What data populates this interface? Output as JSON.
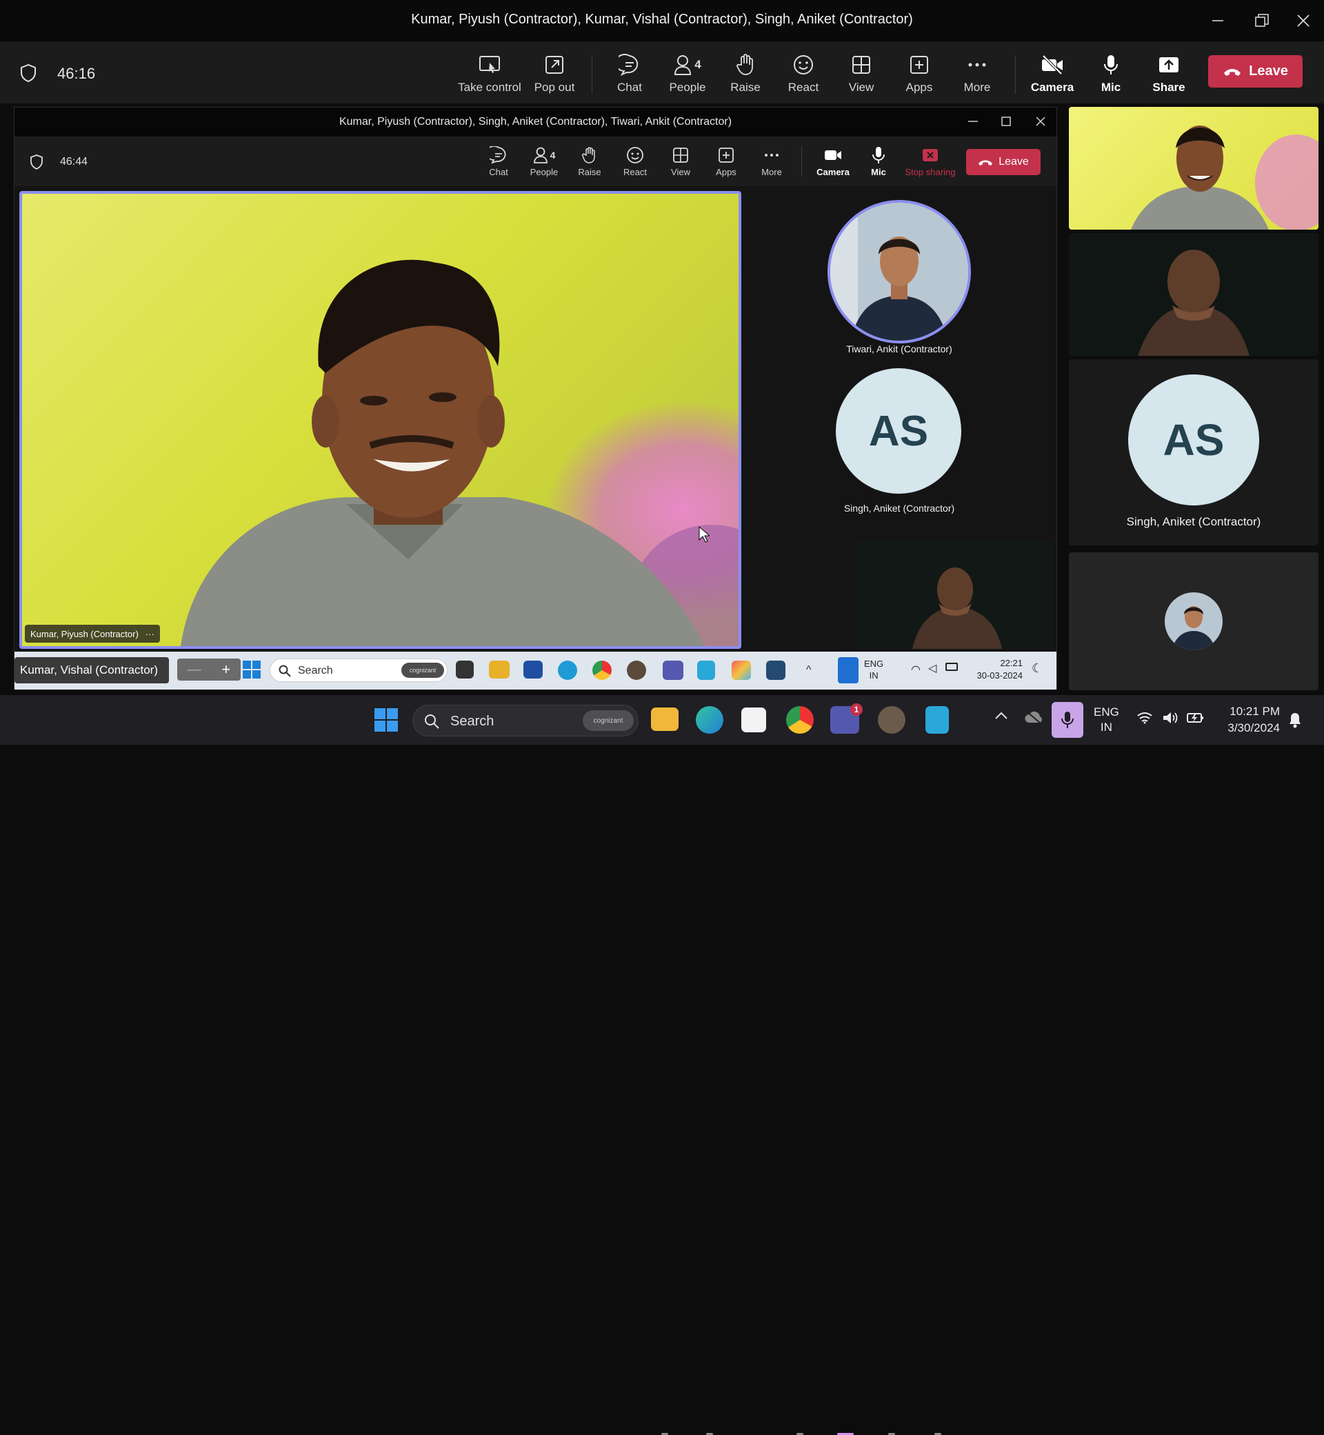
{
  "window": {
    "title": "Kumar, Piyush (Contractor), Kumar, Vishal (Contractor), Singh, Aniket (Contractor)"
  },
  "meeting_bar": {
    "timer": "46:16",
    "buttons": {
      "take_control": "Take control",
      "pop_out": "Pop out",
      "chat": "Chat",
      "people": "People",
      "people_count": "4",
      "raise": "Raise",
      "react": "React",
      "view": "View",
      "apps": "Apps",
      "more": "More",
      "camera": "Camera",
      "mic": "Mic",
      "share": "Share",
      "leave": "Leave"
    }
  },
  "shared_window": {
    "title": "Kumar, Piyush (Contractor), Singh, Aniket (Contractor), Tiwari, Ankit (Contractor)",
    "timer": "46:44",
    "buttons": {
      "chat": "Chat",
      "people": "People",
      "people_count": "4",
      "raise": "Raise",
      "react": "React",
      "view": "View",
      "apps": "Apps",
      "more": "More",
      "camera": "Camera",
      "mic": "Mic",
      "stop_sharing": "Stop sharing",
      "leave": "Leave"
    },
    "main_speaker": "Kumar, Piyush (Contractor)",
    "participants": [
      {
        "name": "Tiwari, Ankit (Contractor)"
      },
      {
        "name": "Singh, Aniket (Contractor)",
        "initials": "AS"
      }
    ],
    "self_label": "Kumar, Vishal (Contractor)",
    "taskbar": {
      "search_placeholder": "Search",
      "search_badge": "cognizant",
      "lang": "ENG",
      "region": "IN",
      "time": "22:21",
      "date": "30-03-2024"
    }
  },
  "side_panel": {
    "participant": {
      "name": "Singh, Aniket (Contractor)",
      "initials": "AS"
    }
  },
  "taskbar": {
    "search_placeholder": "Search",
    "search_badge": "cognizant",
    "lang": "ENG",
    "region": "IN",
    "time": "10:21 PM",
    "date": "3/30/2024",
    "teams_badge": "1"
  },
  "colors": {
    "leave": "#c4314b",
    "accent": "#8b8ef0",
    "avatar_bg": "#d5e6ed",
    "avatar_text": "#24424f"
  }
}
